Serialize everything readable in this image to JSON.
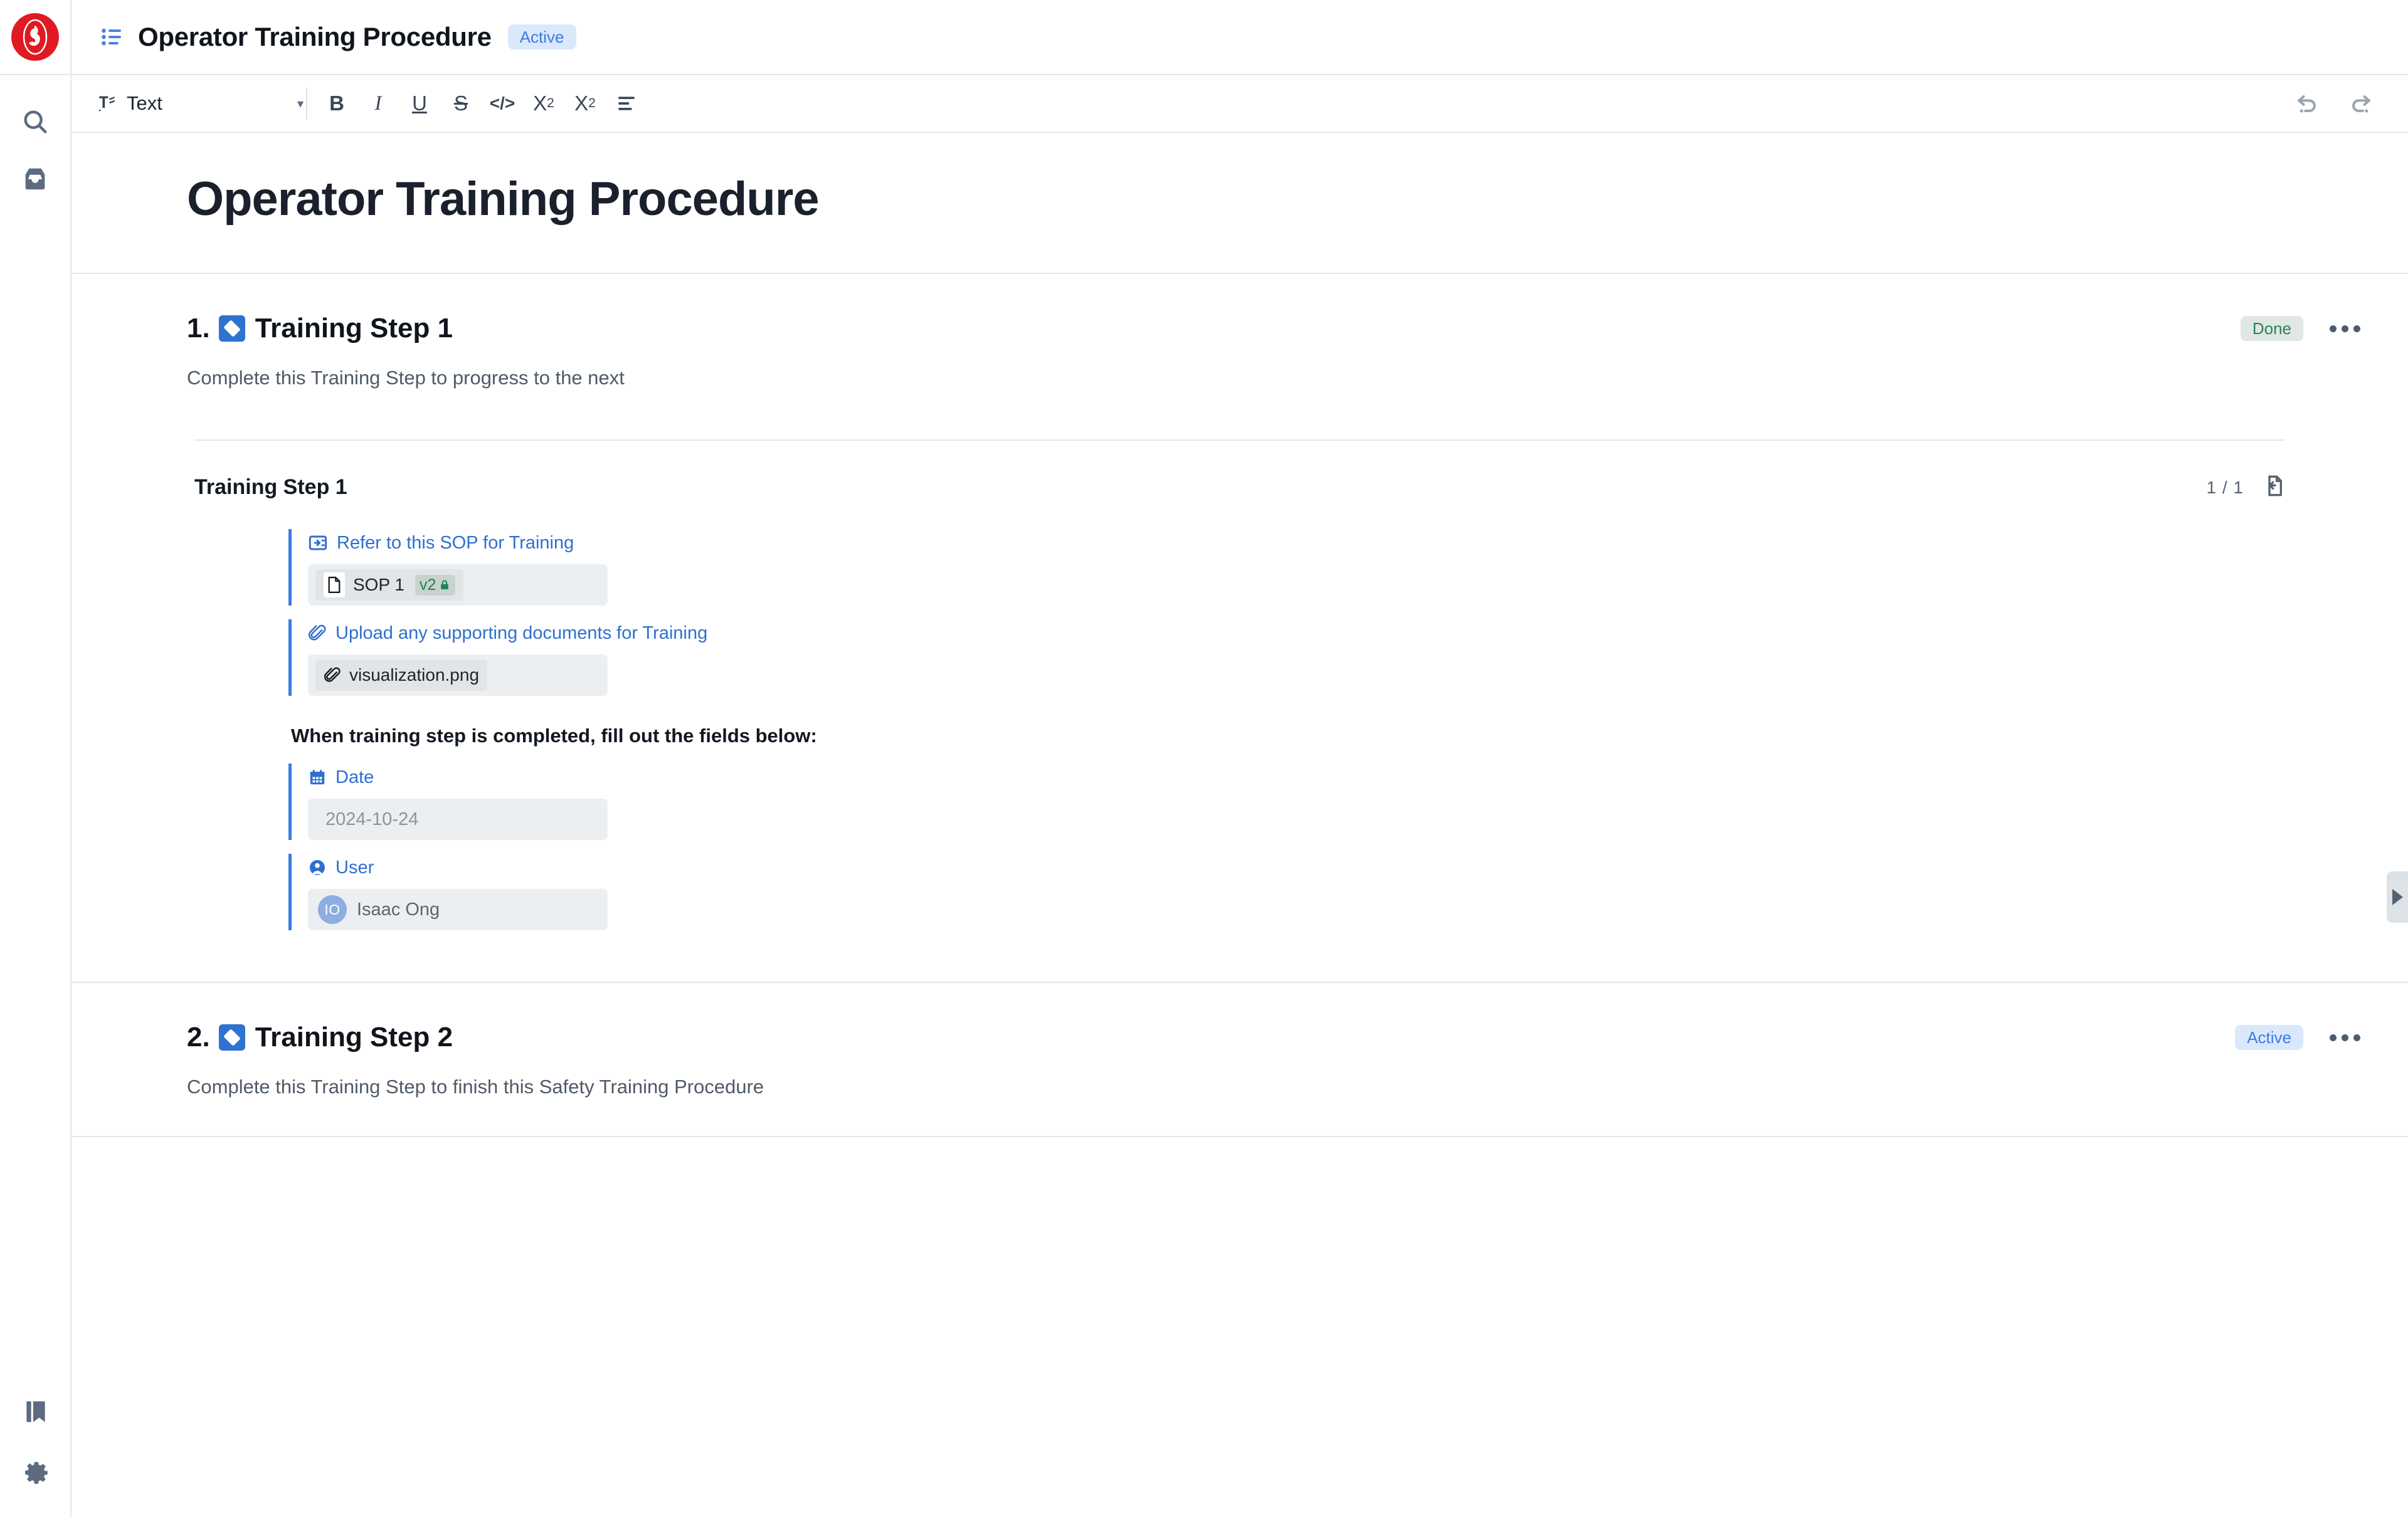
{
  "rail": {
    "logo_name": "company-logo",
    "icons": [
      {
        "name": "search-icon",
        "label": "Search"
      },
      {
        "name": "inbox-icon",
        "label": "Inbox"
      },
      {
        "name": "library-icon",
        "label": "Library"
      },
      {
        "name": "settings-gear-icon",
        "label": "Settings"
      }
    ]
  },
  "header": {
    "list_icon": "list-icon",
    "title": "Operator Training Procedure",
    "status_badge": "Active"
  },
  "toolbar": {
    "style_label": "Text",
    "caret": "▾",
    "bold": "B",
    "italic": "I",
    "underline": "U",
    "strikethrough": "S",
    "code": "</>",
    "superscript_base": "X",
    "superscript_sup": "2",
    "subscript_base": "X",
    "subscript_sub": "2",
    "align_label": "align-left",
    "undo_label": "Undo",
    "redo_label": "Redo"
  },
  "document": {
    "title": "Operator Training Procedure",
    "steps": [
      {
        "number": "1.",
        "title": "Training Step 1",
        "status": "Done",
        "description": "Complete this Training Step to progress to the next",
        "substep": {
          "title": "Training Step 1",
          "page_count": "1 / 1",
          "export_icon": "document-export-icon",
          "fields": [
            {
              "kind": "sop",
              "icon": "sop-reference-icon",
              "label": "Refer to this SOP for Training",
              "chip_icon": "document-icon",
              "chip_value": "SOP 1",
              "version_badge": "v2",
              "lock_icon": "lock-icon"
            },
            {
              "kind": "attachment",
              "icon": "paperclip-icon",
              "label": "Upload any supporting documents for Training",
              "chip_icon": "paperclip-icon",
              "chip_value": "visualization.png"
            }
          ],
          "note": "When training step is completed, fill out the fields below:",
          "completion_fields": [
            {
              "kind": "date",
              "icon": "calendar-icon",
              "label": "Date",
              "value": "2024-10-24"
            },
            {
              "kind": "user",
              "icon": "user-icon",
              "label": "User",
              "avatar_initials": "IO",
              "value": "Isaac Ong"
            }
          ]
        }
      },
      {
        "number": "2.",
        "title": "Training Step 2",
        "status": "Active",
        "description": "Complete this Training Step to finish this Safety Training Procedure"
      }
    ]
  },
  "panel_tab": {
    "name": "expand-right-panel",
    "glyph": "▶"
  },
  "colors": {
    "accent_blue": "#2f72d0",
    "badge_active_bg": "#dbe8fb",
    "badge_active_fg": "#3b7ce0",
    "badge_done_bg": "#e0e7e4",
    "badge_done_fg": "#2f8058",
    "logo_red": "#e01a22",
    "link_blue": "#2f6fd0"
  }
}
